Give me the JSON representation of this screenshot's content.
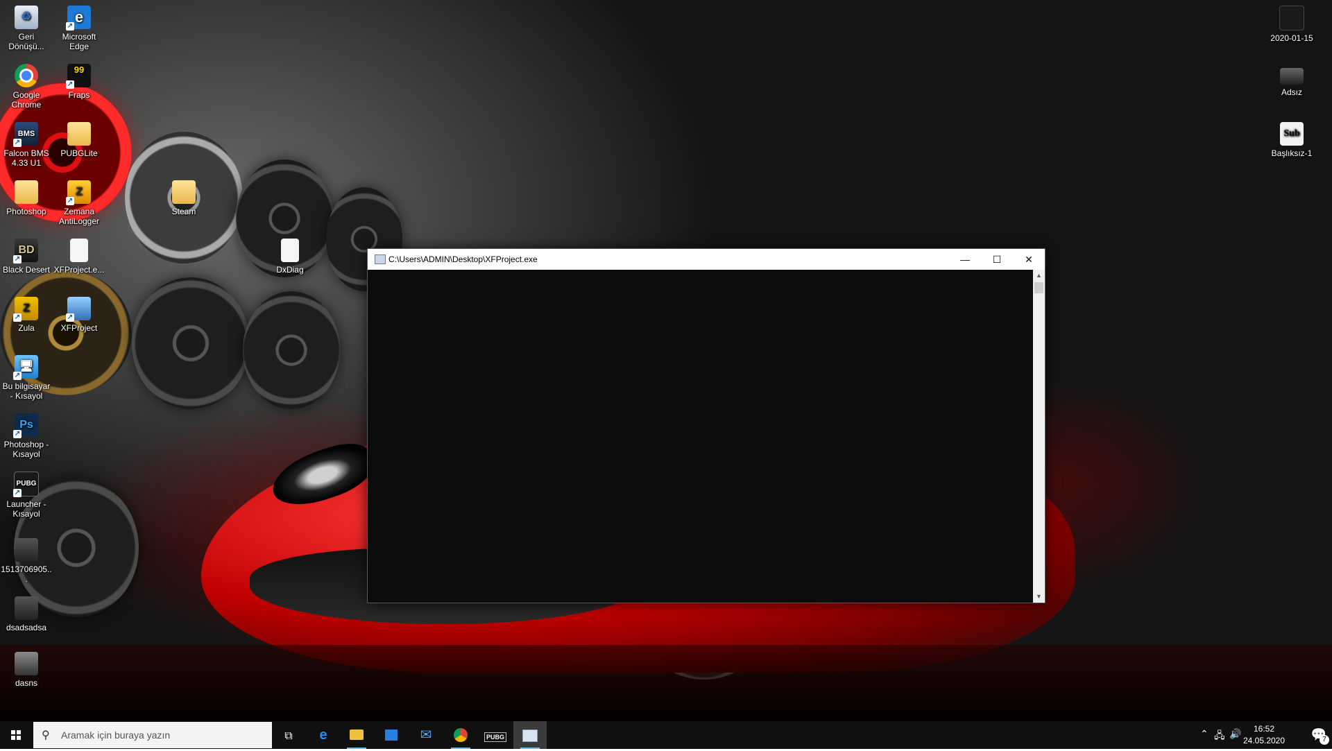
{
  "desktop_icons": [
    {
      "label": "Geri Dönüşü...",
      "icon": "recycle-bin-icon"
    },
    {
      "label": "Microsoft Edge",
      "icon": "edge-icon"
    },
    {
      "label": "Google Chrome",
      "icon": "chrome-icon"
    },
    {
      "label": "Fraps",
      "icon": "fraps-icon"
    },
    {
      "label": "Falcon BMS 4.33 U1",
      "icon": "falcon-bms-icon"
    },
    {
      "label": "PUBGLite",
      "icon": "folder-icon"
    },
    {
      "label": "Photoshop",
      "icon": "folder-icon"
    },
    {
      "label": "Zemana AntiLogger",
      "icon": "zemana-icon"
    },
    {
      "label": "Steam",
      "icon": "folder-icon"
    },
    {
      "label": "Black Desert",
      "icon": "black-desert-icon"
    },
    {
      "label": "XFProject.e...",
      "icon": "file-icon"
    },
    {
      "label": "DxDiag",
      "icon": "text-file-icon"
    },
    {
      "label": "Zula",
      "icon": "zula-icon"
    },
    {
      "label": "XFProject",
      "icon": "xfproject-icon"
    },
    {
      "label": "Bu bilgisayar - Kısayol",
      "icon": "this-pc-icon"
    },
    {
      "label": "Photoshop - Kısayol",
      "icon": "photoshop-icon"
    },
    {
      "label": "Launcher - Kısayol",
      "icon": "pubg-launcher-icon"
    },
    {
      "label": "1513706905...",
      "icon": "image-file-icon"
    },
    {
      "label": "dsadsadsa",
      "icon": "image-file-icon"
    },
    {
      "label": "dasns",
      "icon": "image-file-icon"
    },
    {
      "label": "2020-01-15",
      "icon": "image-file-icon"
    },
    {
      "label": "Adsız",
      "icon": "image-file-icon"
    },
    {
      "label": "Başlıksız-1",
      "icon": "image-file-icon"
    }
  ],
  "console": {
    "title": "C:\\Users\\ADMIN\\Desktop\\XFProject.exe",
    "minimize": "—",
    "maximize": "☐",
    "close": "✕"
  },
  "taskbar": {
    "search_placeholder": "Aramak için buraya yazın",
    "apps": [
      {
        "name": "task-view",
        "icon": "task-view-icon"
      },
      {
        "name": "edge",
        "icon": "edge-icon"
      },
      {
        "name": "file-explorer",
        "icon": "folder-icon"
      },
      {
        "name": "store",
        "icon": "store-icon"
      },
      {
        "name": "mail",
        "icon": "mail-icon"
      },
      {
        "name": "chrome",
        "icon": "chrome-icon"
      },
      {
        "name": "pubg",
        "icon": "pubg-icon"
      },
      {
        "name": "console",
        "icon": "console-icon"
      }
    ],
    "time": "16:52",
    "date": "24.05.2020",
    "notification_count": "7"
  },
  "colors": {
    "taskbar": "#101010",
    "console_bg": "#0c0c0c",
    "active_underline": "#76b9ed"
  }
}
